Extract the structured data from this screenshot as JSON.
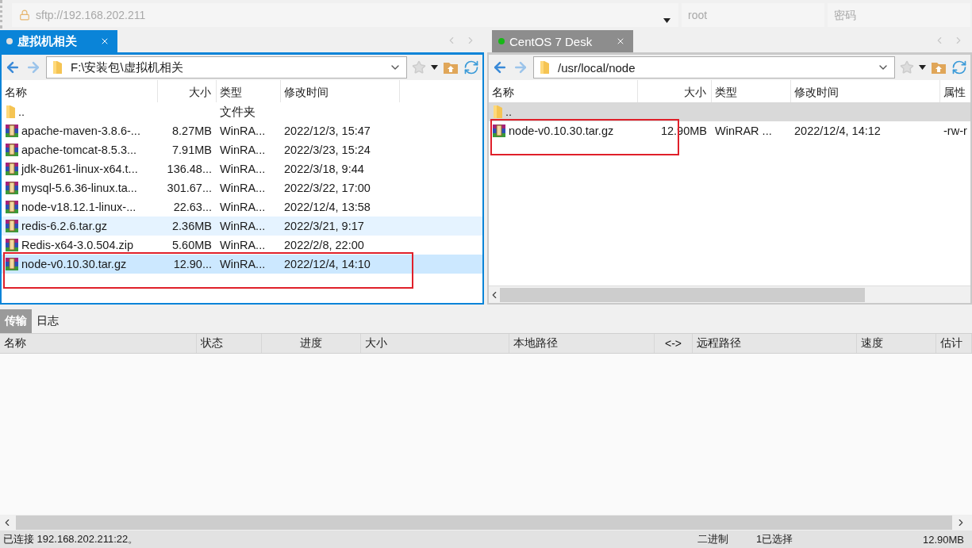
{
  "connection": {
    "host_placeholder": "sftp://192.168.202.211",
    "user_placeholder": "root",
    "password_placeholder": "密码"
  },
  "panels": [
    {
      "tab": {
        "label": "虚拟机相关",
        "connected": false
      },
      "active": true,
      "path": "F:\\安装包\\虚拟机相关",
      "columns": [
        "名称",
        "大小",
        "类型",
        "修改时间"
      ],
      "rows": [
        {
          "kind": "folder",
          "cells": [
            "..",
            "",
            "文件夹",
            ""
          ],
          "selected": false,
          "hovered": false,
          "highlighted": false
        },
        {
          "kind": "archive",
          "cells": [
            "apache-maven-3.8.6-...",
            "8.27MB",
            "WinRA...",
            "2022/12/3, 15:47"
          ],
          "selected": false,
          "hovered": false,
          "highlighted": false
        },
        {
          "kind": "archive",
          "cells": [
            "apache-tomcat-8.5.3...",
            "7.91MB",
            "WinRA...",
            "2022/3/23, 15:24"
          ],
          "selected": false,
          "hovered": false,
          "highlighted": false
        },
        {
          "kind": "archive",
          "cells": [
            "jdk-8u261-linux-x64.t...",
            "136.48...",
            "WinRA...",
            "2022/3/18, 9:44"
          ],
          "selected": false,
          "hovered": false,
          "highlighted": false
        },
        {
          "kind": "archive",
          "cells": [
            "mysql-5.6.36-linux.ta...",
            "301.67...",
            "WinRA...",
            "2022/3/22, 17:00"
          ],
          "selected": false,
          "hovered": false,
          "highlighted": false
        },
        {
          "kind": "archive",
          "cells": [
            "node-v18.12.1-linux-...",
            "22.63...",
            "WinRA...",
            "2022/12/4, 13:58"
          ],
          "selected": false,
          "hovered": false,
          "highlighted": false
        },
        {
          "kind": "archive",
          "cells": [
            "redis-6.2.6.tar.gz",
            "2.36MB",
            "WinRA...",
            "2022/3/21, 9:17"
          ],
          "selected": false,
          "hovered": true,
          "highlighted": false
        },
        {
          "kind": "archive",
          "cells": [
            "Redis-x64-3.0.504.zip",
            "5.60MB",
            "WinRA...",
            "2022/2/8, 22:00"
          ],
          "selected": false,
          "hovered": false,
          "highlighted": false
        },
        {
          "kind": "archive",
          "cells": [
            "node-v0.10.30.tar.gz",
            "12.90...",
            "WinRA...",
            "2022/12/4, 14:10"
          ],
          "selected": true,
          "hovered": false,
          "highlighted": true
        }
      ]
    },
    {
      "tab": {
        "label": "CentOS 7 Desk",
        "connected": true
      },
      "active": false,
      "path": "/usr/local/node",
      "columns": [
        "名称",
        "大小",
        "类型",
        "修改时间",
        "属性"
      ],
      "rows": [
        {
          "kind": "folder",
          "cells": [
            "..",
            "",
            "",
            "",
            ""
          ],
          "selected": true,
          "hovered": false,
          "highlighted": false
        },
        {
          "kind": "archive",
          "cells": [
            "node-v0.10.30.tar.gz",
            "12.90MB",
            "WinRAR ...",
            "2022/12/4, 14:12",
            "-rw-r"
          ],
          "selected": false,
          "hovered": false,
          "highlighted": true
        }
      ]
    }
  ],
  "transfer": {
    "tabs": [
      {
        "label": "传输",
        "selected": true
      },
      {
        "label": "日志",
        "selected": false
      }
    ],
    "columns": [
      "名称",
      "状态",
      "进度",
      "大小",
      "本地路径",
      "<->",
      "远程路径",
      "速度",
      "估计"
    ]
  },
  "status_bar": {
    "message": "已连接 192.168.202.211:22。",
    "mode": "二进制",
    "selection": "1已选择",
    "size": "12.90MB"
  }
}
